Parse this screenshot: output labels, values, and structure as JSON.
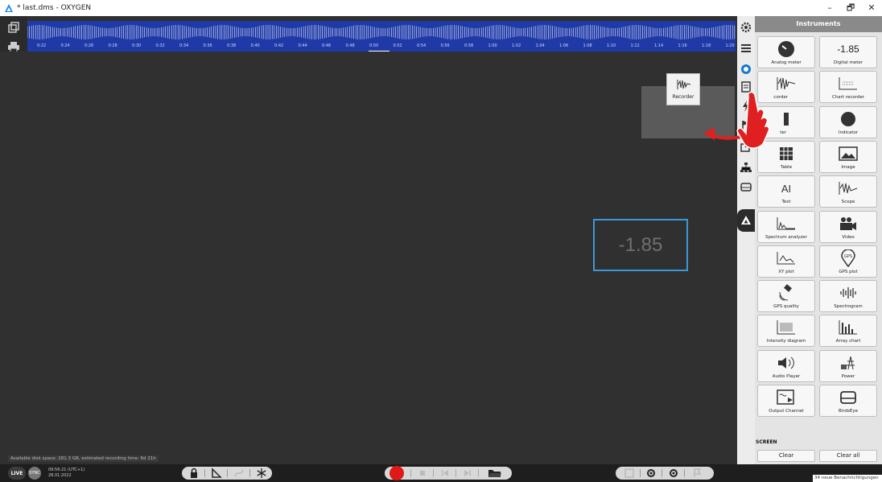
{
  "window": {
    "title": "* last.dms - OXYGEN",
    "controls": [
      "–",
      "🗗",
      "✕"
    ]
  },
  "timeline": {
    "ticks": [
      "0:22",
      "0:24",
      "0:26",
      "0:28",
      "0:30",
      "0:32",
      "0:34",
      "0:36",
      "0:38",
      "0:40",
      "0:42",
      "0:44",
      "0:46",
      "0:48",
      "0:50",
      "0:52",
      "0:54",
      "0:56",
      "0:58",
      "1:00",
      "1:02",
      "1:04",
      "1:06",
      "1:08",
      "1:10",
      "1:12",
      "1:14",
      "1:16",
      "1:18",
      "1:20"
    ],
    "color": "#1f3aa6"
  },
  "canvas": {
    "drag_ghost_label": "Recorder",
    "digital_meter_value": "-1.85",
    "disk_info": "Available disk space: 281.3 GB, estimated recording time: 6d 21h"
  },
  "statusbar": {
    "live_label": "LIVE",
    "sync_label": "SYNC",
    "time": "09:56:21 (UTC+1)",
    "date": "28.01.2022"
  },
  "panel": {
    "header": "Instruments",
    "instruments": [
      {
        "label": "Analog meter",
        "icon": "analog-meter-icon"
      },
      {
        "label": "Digital meter",
        "icon": "digital-meter-icon",
        "value": "-1.85"
      },
      {
        "label": "Recorder",
        "icon": "recorder-icon",
        "partial": "corder"
      },
      {
        "label": "Chart recorder",
        "icon": "chart-recorder-icon"
      },
      {
        "label": "Bar meter",
        "icon": "bar-meter-icon",
        "partial": "ter"
      },
      {
        "label": "Indicator",
        "icon": "indicator-icon"
      },
      {
        "label": "Table",
        "icon": "table-icon"
      },
      {
        "label": "Image",
        "icon": "image-icon"
      },
      {
        "label": "Text",
        "icon": "text-icon"
      },
      {
        "label": "Scope",
        "icon": "scope-icon"
      },
      {
        "label": "Spectrum analyzer",
        "icon": "spectrum-analyzer-icon"
      },
      {
        "label": "Video",
        "icon": "video-icon"
      },
      {
        "label": "XY plot",
        "icon": "xy-plot-icon"
      },
      {
        "label": "GPS plot",
        "icon": "gps-plot-icon"
      },
      {
        "label": "GPS quality",
        "icon": "gps-quality-icon"
      },
      {
        "label": "Spectrogram",
        "icon": "spectrogram-icon"
      },
      {
        "label": "Intensity diagram",
        "icon": "intensity-diagram-icon"
      },
      {
        "label": "Array chart",
        "icon": "array-chart-icon"
      },
      {
        "label": "Audio Player",
        "icon": "audio-player-icon"
      },
      {
        "label": "Power",
        "icon": "power-icon"
      },
      {
        "label": "Output Channel",
        "icon": "output-channel-icon"
      },
      {
        "label": "BirdsEye",
        "icon": "birdseye-icon"
      }
    ],
    "screen_section": "SCREEN",
    "clear_label": "Clear",
    "clear_all_label": "Clear all"
  },
  "notification": "34 neue Benachrichtigungen"
}
